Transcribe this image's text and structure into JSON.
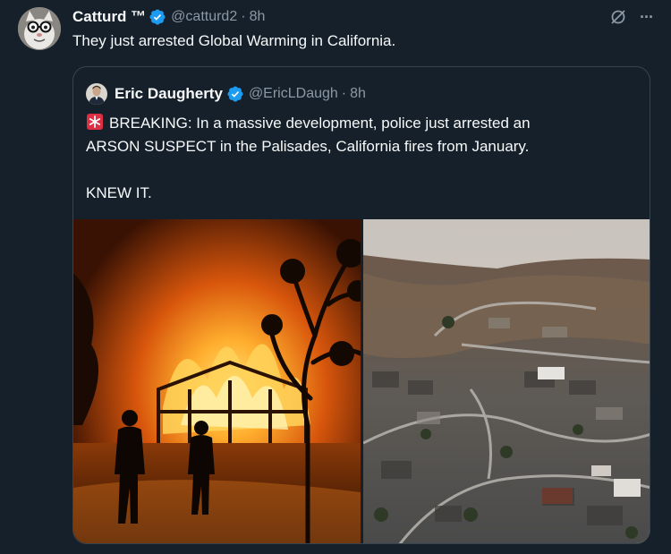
{
  "tweet": {
    "author_name": "Catturd ™",
    "author_handle": "@catturd2",
    "separator": "·",
    "time": "8h",
    "text": "They just arrested Global Warming in California.",
    "verified_color": "#1d9bf0"
  },
  "actions": {
    "grok_icon": "grok-icon",
    "more_icon": "more-icon",
    "more_glyph": "···"
  },
  "quote": {
    "author_name": "Eric Daugherty",
    "author_handle": "@EricLDaugh",
    "separator": "·",
    "time": "8h",
    "line1": "BREAKING: In a massive development, police just arrested an",
    "line2": "ARSON SUSPECT in the Palisades, California fires from January.",
    "line3": "KNEW IT.",
    "emoji": "siren-emoji"
  },
  "media": {
    "left": "house-fire-photo",
    "right": "burned-neighborhood-aerial-photo"
  },
  "colors": {
    "background": "#15202b",
    "text": "#f7f9f9",
    "muted": "#8b98a5",
    "border": "#38444d",
    "accent": "#1d9bf0"
  }
}
